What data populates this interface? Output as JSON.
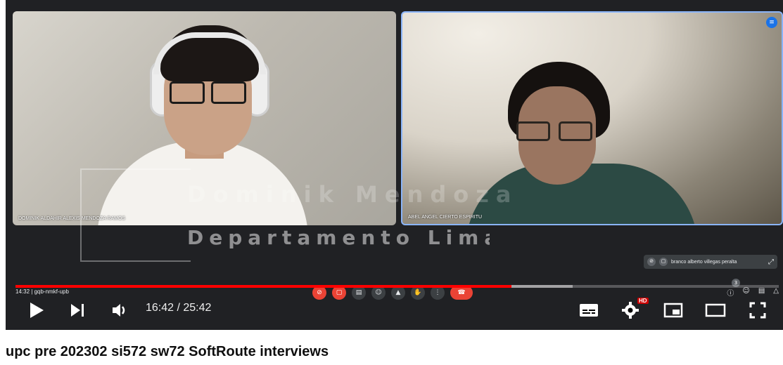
{
  "meet": {
    "left_participant_name": "DOMINIK ALDAHIR ALEXIS MENDOZA RAMOS",
    "right_participant_name": "ABEL ANGEL CIERTO ESPIRITU",
    "other_participant_name": "branco alberto villegas peralta",
    "meeting_time": "14:32",
    "meeting_code": "gqb-nmkf-upb",
    "people_count": "3",
    "speaking_icon": "audio-wave-icon"
  },
  "watermark": {
    "name": "Dominik Mendoza",
    "department": "Departamento Lima"
  },
  "player": {
    "time_display": "16:42 / 25:42",
    "hd_badge": "HD",
    "progress_played_fraction": 0.65,
    "progress_loaded_fraction": 0.73,
    "accent_color": "#ff0000"
  },
  "video": {
    "title": "upc pre 202302 si572 sw72 SoftRoute interviews"
  }
}
